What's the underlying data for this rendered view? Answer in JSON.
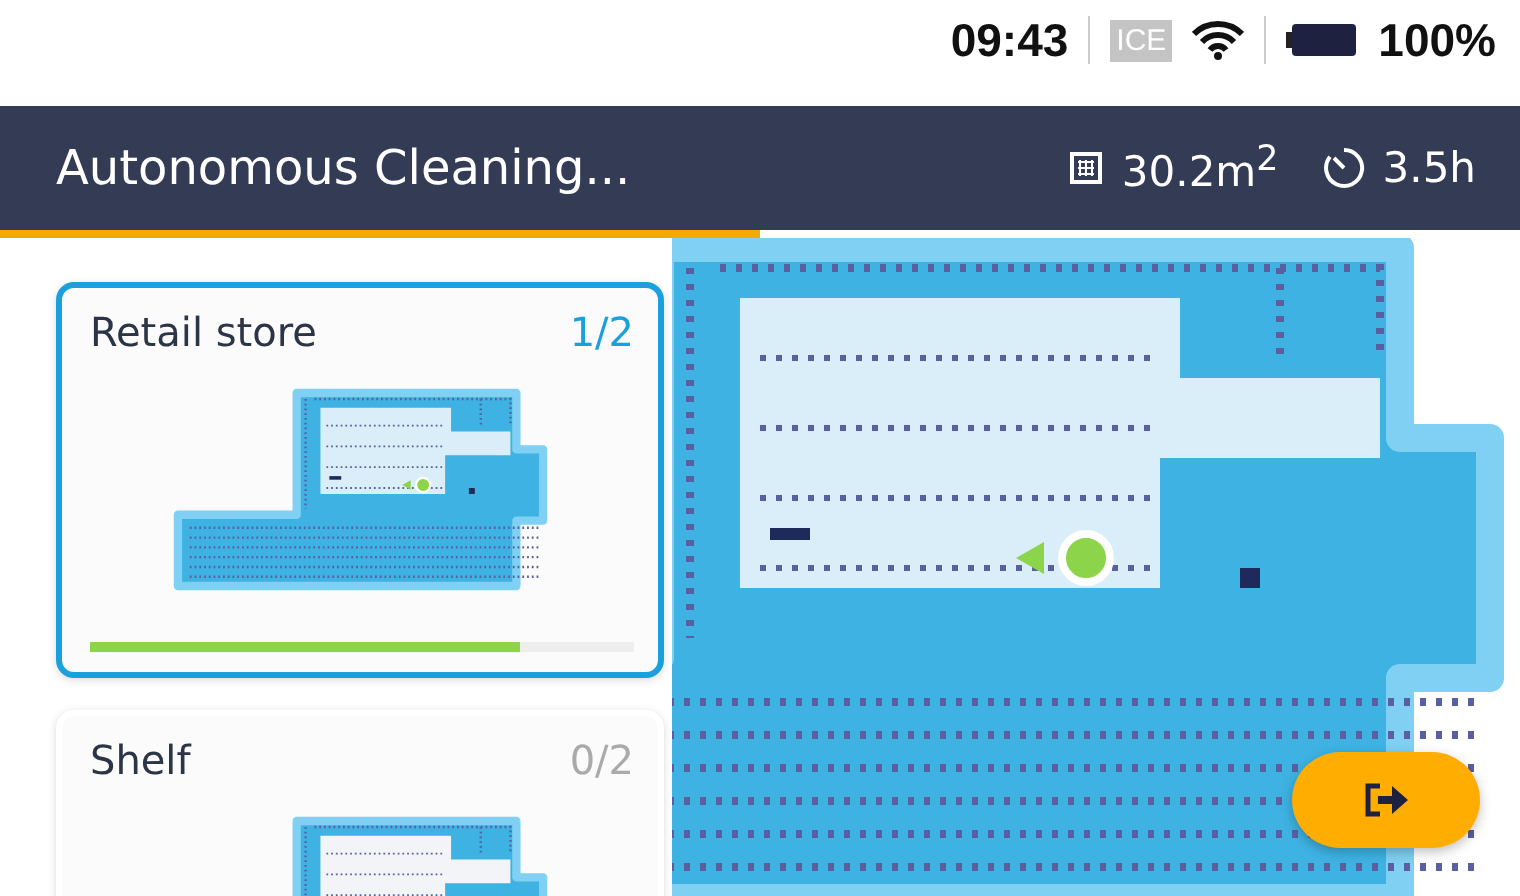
{
  "status_bar": {
    "time": "09:43",
    "network": "ICE",
    "battery": "100%"
  },
  "header": {
    "title": "Autonomous Cleaning...",
    "area": "30.2m$^{2}$",
    "duration": "3.5h",
    "level": 0.5
  },
  "tasks": [
    {
      "name": "Retail store",
      "count": "1/2",
      "selected": true,
      "level": 0.79
    },
    {
      "name": "Shelf",
      "count": "0/2",
      "selected": false
    }
  ]
}
